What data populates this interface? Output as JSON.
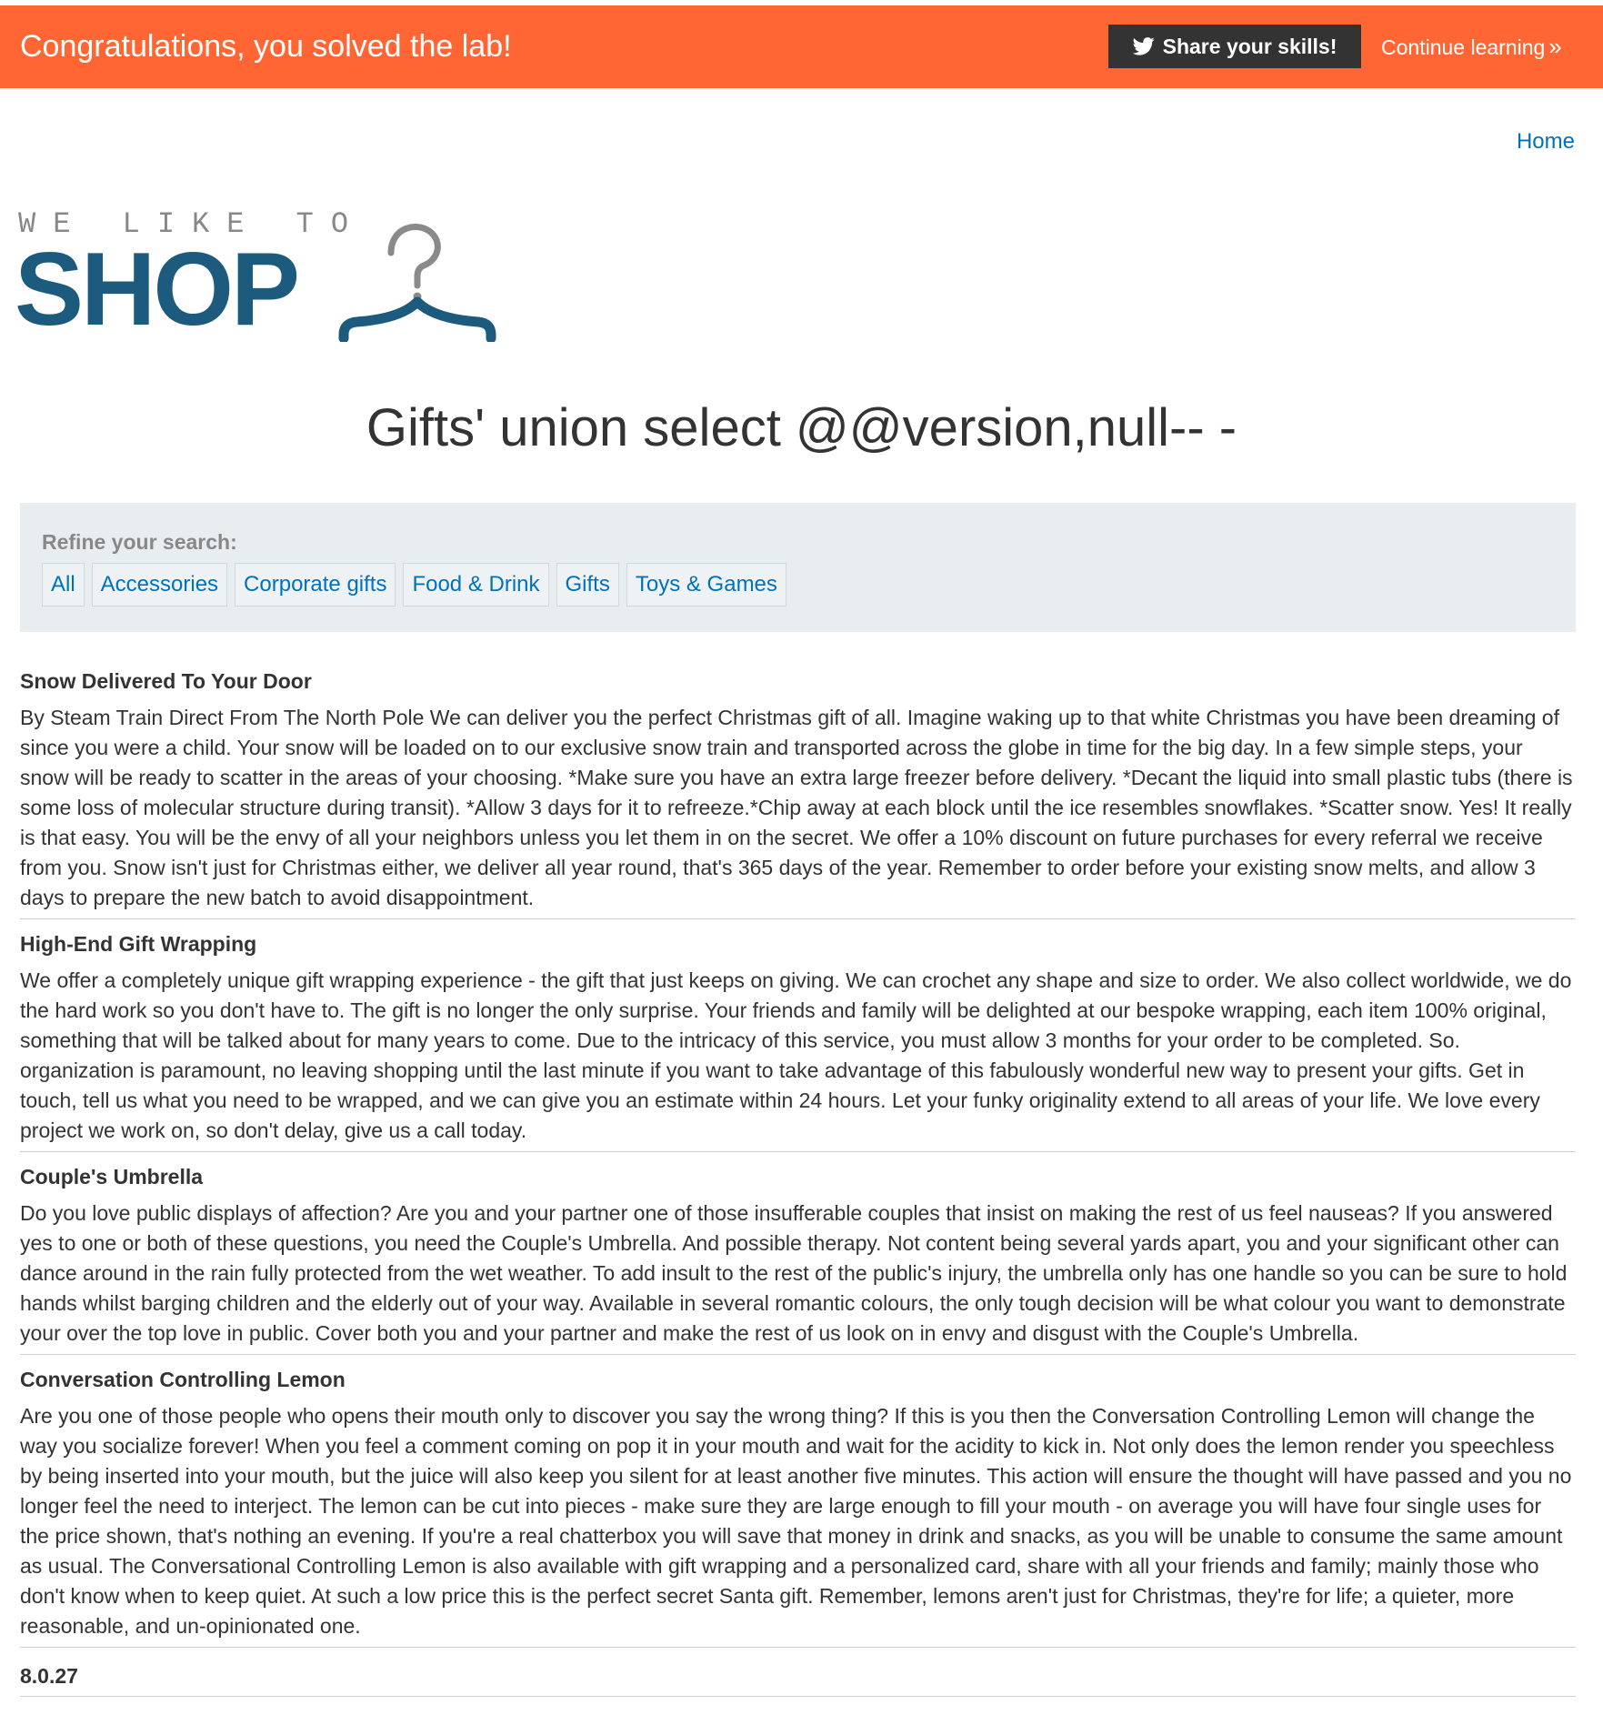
{
  "banner": {
    "message": "Congratulations, you solved the lab!",
    "share_label": "Share your skills!",
    "continue_label": "Continue learning",
    "accent_color": "#ff6633"
  },
  "nav": {
    "home_label": "Home"
  },
  "logo": {
    "tagline": "WE LIKE TO",
    "brand": "SHOP",
    "icon": "hanger-icon"
  },
  "page": {
    "heading": "Gifts' union select @@version,null-- -"
  },
  "refine": {
    "label": "Refine your search:",
    "filters": [
      "All",
      "Accessories",
      "Corporate gifts",
      "Food & Drink",
      "Gifts",
      "Toys & Games"
    ]
  },
  "products": [
    {
      "name": "Snow Delivered To Your Door",
      "description": "By Steam Train Direct From The North Pole We can deliver you the perfect Christmas gift of all. Imagine waking up to that white Christmas you have been dreaming of since you were a child. Your snow will be loaded on to our exclusive snow train and transported across the globe in time for the big day. In a few simple steps, your snow will be ready to scatter in the areas of your choosing. *Make sure you have an extra large freezer before delivery. *Decant the liquid into small plastic tubs (there is some loss of molecular structure during transit). *Allow 3 days for it to refreeze.*Chip away at each block until the ice resembles snowflakes. *Scatter snow. Yes! It really is that easy. You will be the envy of all your neighbors unless you let them in on the secret. We offer a 10% discount on future purchases for every referral we receive from you. Snow isn't just for Christmas either, we deliver all year round, that's 365 days of the year. Remember to order before your existing snow melts, and allow 3 days to prepare the new batch to avoid disappointment."
    },
    {
      "name": "High-End Gift Wrapping",
      "description": "We offer a completely unique gift wrapping experience - the gift that just keeps on giving. We can crochet any shape and size to order. We also collect worldwide, we do the hard work so you don't have to. The gift is no longer the only surprise. Your friends and family will be delighted at our bespoke wrapping, each item 100% original, something that will be talked about for many years to come. Due to the intricacy of this service, you must allow 3 months for your order to be completed. So. organization is paramount, no leaving shopping until the last minute if you want to take advantage of this fabulously wonderful new way to present your gifts. Get in touch, tell us what you need to be wrapped, and we can give you an estimate within 24 hours. Let your funky originality extend to all areas of your life. We love every project we work on, so don't delay, give us a call today."
    },
    {
      "name": "Couple's Umbrella",
      "description": "Do you love public displays of affection? Are you and your partner one of those insufferable couples that insist on making the rest of us feel nauseas? If you answered yes to one or both of these questions, you need the Couple's Umbrella. And possible therapy. Not content being several yards apart, you and your significant other can dance around in the rain fully protected from the wet weather. To add insult to the rest of the public's injury, the umbrella only has one handle so you can be sure to hold hands whilst barging children and the elderly out of your way. Available in several romantic colours, the only tough decision will be what colour you want to demonstrate your over the top love in public. Cover both you and your partner and make the rest of us look on in envy and disgust with the Couple's Umbrella."
    },
    {
      "name": "Conversation Controlling Lemon",
      "description": "Are you one of those people who opens their mouth only to discover you say the wrong thing? If this is you then the Conversation Controlling Lemon will change the way you socialize forever! When you feel a comment coming on pop it in your mouth and wait for the acidity to kick in. Not only does the lemon render you speechless by being inserted into your mouth, but the juice will also keep you silent for at least another five minutes. This action will ensure the thought will have passed and you no longer feel the need to interject. The lemon can be cut into pieces - make sure they are large enough to fill your mouth - on average you will have four single uses for the price shown, that's nothing an evening. If you're a real chatterbox you will save that money in drink and snacks, as you will be unable to consume the same amount as usual. The Conversational Controlling Lemon is also available with gift wrapping and a personalized card, share with all your friends and family; mainly those who don't know when to keep quiet. At such a low price this is the perfect secret Santa gift. Remember, lemons aren't just for Christmas, they're for life; a quieter, more reasonable, and un-opinionated one."
    }
  ],
  "injected_result": {
    "version": "8.0.27"
  }
}
